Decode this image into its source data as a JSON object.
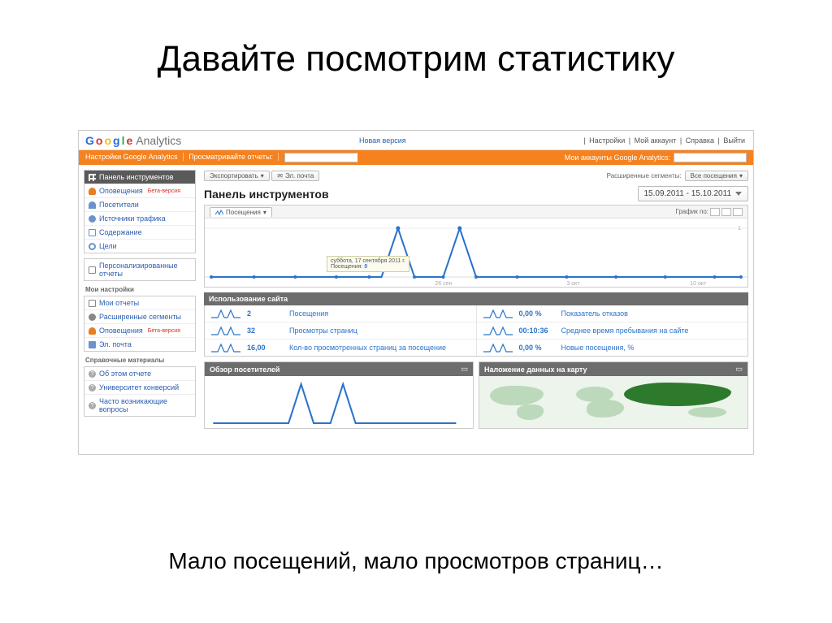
{
  "slide": {
    "title": "Давайте посмотрим статистику",
    "caption": "Мало посещений, мало просмотров страниц…"
  },
  "header": {
    "logo_brand": "Google",
    "logo_suffix": "Analytics",
    "new_version": "Новая версия",
    "links": {
      "settings": "Настройки",
      "my_account": "Мой аккаунт",
      "help": "Справка",
      "exit": "Выйти"
    }
  },
  "orange": {
    "cfg": "Настройки Google Analytics",
    "view": "Просматривайте отчеты:",
    "accounts": "Мои аккаунты Google Analytics:"
  },
  "sidebar": {
    "main": [
      {
        "icon": "grid",
        "label": "Панель инструментов",
        "active": true
      },
      {
        "icon": "bell",
        "label": "Оповещения",
        "badge": "Бета-версия"
      },
      {
        "icon": "person",
        "label": "Посетители"
      },
      {
        "icon": "globe",
        "label": "Источники трафика"
      },
      {
        "icon": "page",
        "label": "Содержание"
      },
      {
        "icon": "target",
        "label": "Цели"
      }
    ],
    "extra": [
      {
        "icon": "doc",
        "label": "Персонализированные отчеты"
      }
    ],
    "my_title": "Мои настройки",
    "my": [
      {
        "icon": "doc",
        "label": "Мои отчеты"
      },
      {
        "icon": "gear",
        "label": "Расширенные сегменты"
      },
      {
        "icon": "bell",
        "label": "Оповещения",
        "badge": "Бета-версия"
      },
      {
        "icon": "mail",
        "label": "Эл. почта"
      }
    ],
    "ref_title": "Справочные материалы",
    "ref": [
      {
        "icon": "q",
        "label": "Об этом отчете"
      },
      {
        "icon": "q",
        "label": "Университет конверсий"
      },
      {
        "icon": "q",
        "label": "Часто возникающие вопросы"
      }
    ]
  },
  "main": {
    "export": "Экспортировать",
    "email": "Эл. почта",
    "segments_label": "Расширенные сегменты:",
    "segments_value": "Все посещения",
    "panel_title": "Панель инструментов",
    "date_range": "15.09.2011 - 15.10.2011",
    "chart_tab": "Посещения",
    "graphic_label": "График по:",
    "tooltip_line1": "суббота, 17 сентября 2011 г.",
    "tooltip_metric": "Посещения:",
    "tooltip_value": "0",
    "xaxis": [
      "26 сен",
      "3 окт",
      "10 окт"
    ],
    "usage_title": "Использование сайта",
    "metrics_left": [
      {
        "value": "2",
        "label": "Посещения"
      },
      {
        "value": "32",
        "label": "Просмотры страниц"
      },
      {
        "value": "16,00",
        "label": "Кол-во просмотренных страниц за посещение"
      }
    ],
    "metrics_right": [
      {
        "value": "0,00 %",
        "label": "Показатель отказов"
      },
      {
        "value": "00:10:36",
        "label": "Среднее время пребывания на сайте"
      },
      {
        "value": "0,00 %",
        "label": "Новые посещения, %"
      }
    ],
    "bottom_left_title": "Обзор посетителей",
    "bottom_right_title": "Наложение данных на карту"
  },
  "chart_data": {
    "type": "line",
    "title": "Посещения",
    "x_range": [
      "15.09.2011",
      "15.10.2011"
    ],
    "series": [
      {
        "name": "Посещения",
        "values": [
          0,
          0,
          0,
          0,
          0,
          0,
          0,
          0,
          0,
          1,
          0,
          0,
          0,
          0,
          1,
          0,
          0,
          0,
          0,
          0,
          0,
          0,
          0,
          0,
          0,
          0,
          0,
          0,
          0,
          0,
          0
        ]
      }
    ],
    "ylim": [
      0,
      1
    ],
    "categories_ticks": [
      "26 сен",
      "3 окт",
      "10 окт"
    ]
  }
}
